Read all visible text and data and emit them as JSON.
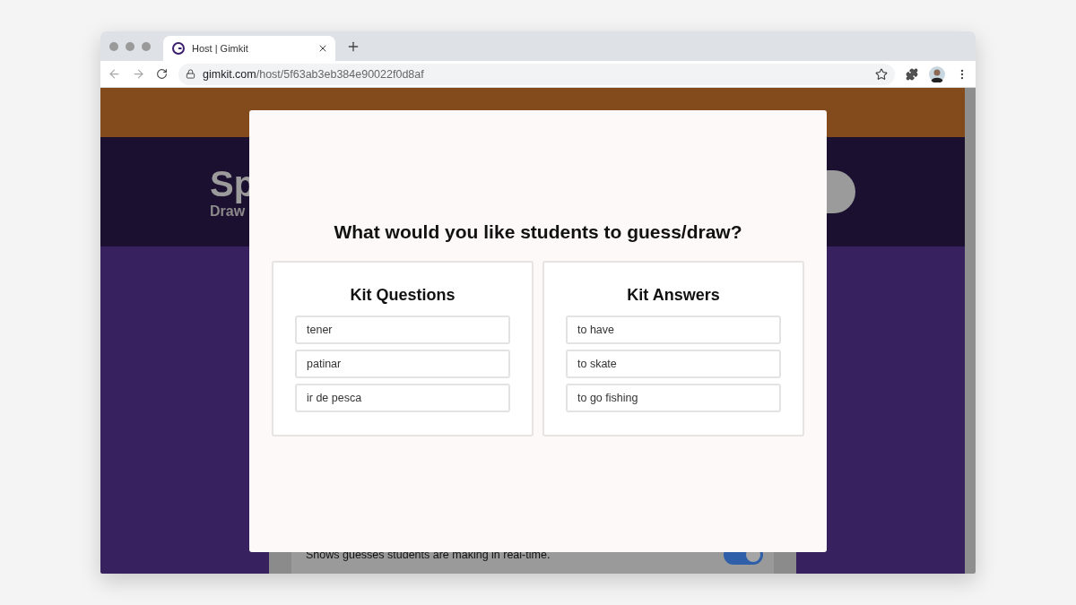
{
  "browser": {
    "tab": {
      "title": "Host | Gimkit",
      "selected": true
    },
    "url": {
      "host": "gimkit.com",
      "path": "/host/5f63ab3eb384e90022f0d8af"
    }
  },
  "page": {
    "heading": "Sp",
    "subheading": "Draw",
    "setting": {
      "description": "Shows guesses students are making in real-time.",
      "on": true
    }
  },
  "modal": {
    "title": "What would you like students to guess/draw?",
    "options": [
      {
        "title": "Kit Questions",
        "items": [
          "tener",
          "patinar",
          "ir de pesca"
        ]
      },
      {
        "title": "Kit Answers",
        "items": [
          "to have",
          "to skate",
          "to go fishing"
        ]
      }
    ]
  }
}
